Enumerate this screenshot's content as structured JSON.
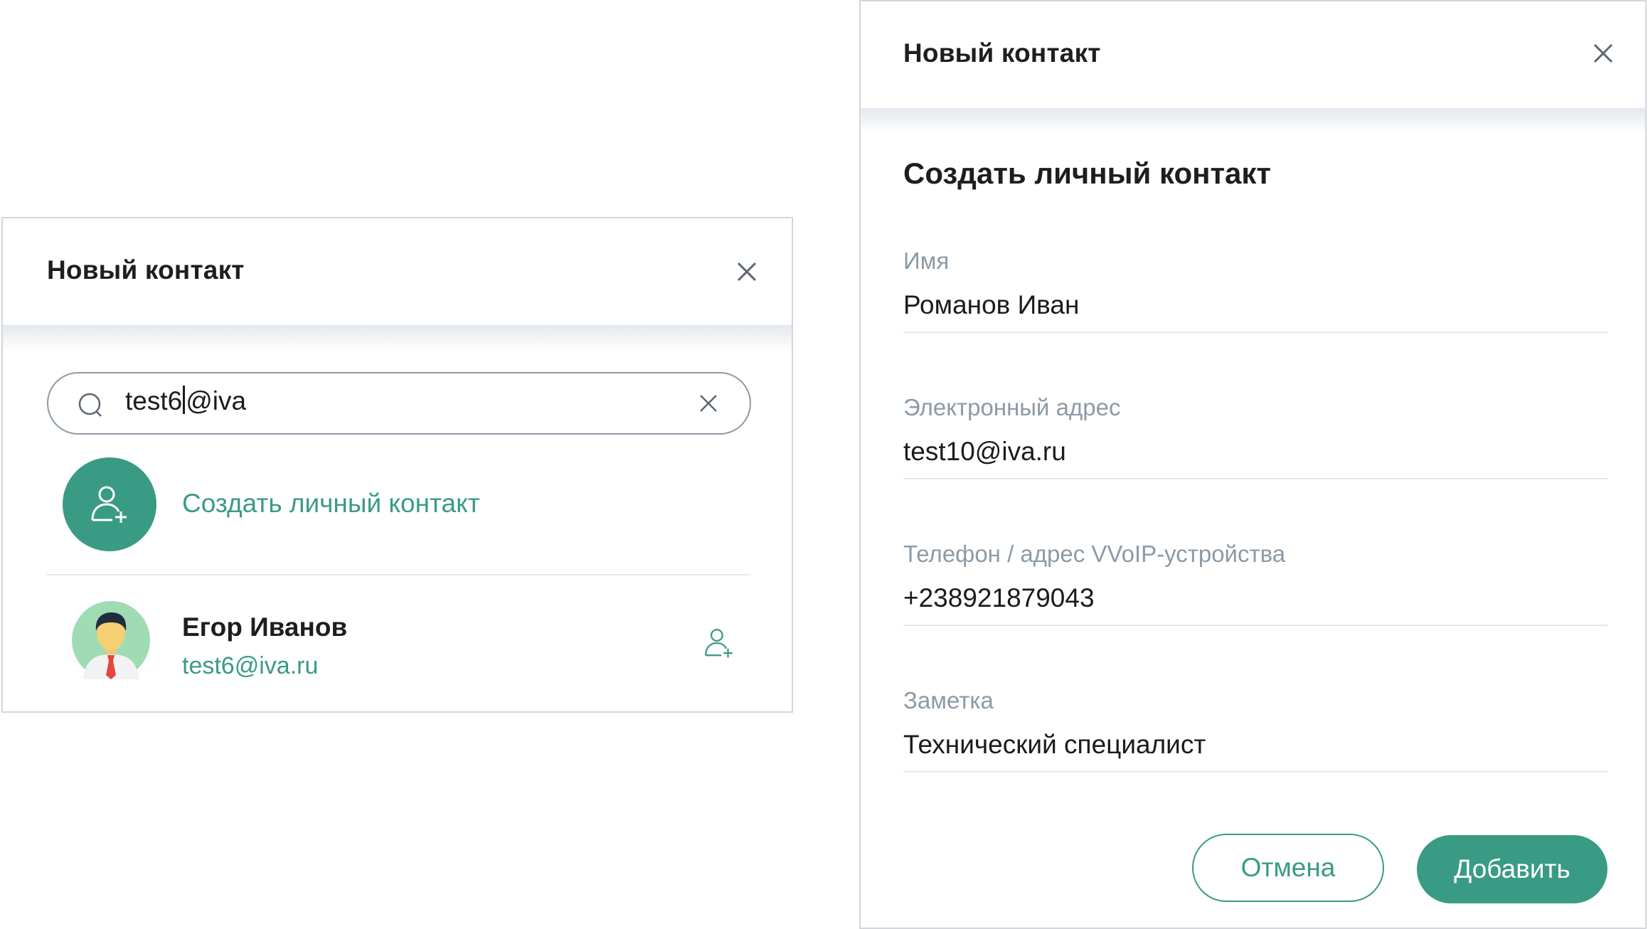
{
  "left_panel": {
    "title": "Новый контакт",
    "search": {
      "value_before_caret": "test6",
      "value_after_caret": "@iva"
    },
    "create_label": "Создать личный контакт",
    "contact": {
      "name": "Егор Иванов",
      "email": "test6@iva.ru"
    }
  },
  "right_panel": {
    "title": "Новый контакт",
    "heading": "Создать личный контакт",
    "fields": [
      {
        "label": "Имя",
        "value": "Романов Иван"
      },
      {
        "label": "Электронный адрес",
        "value": "test10@iva.ru"
      },
      {
        "label": "Телефон / адрес VVoIP-устройства",
        "value": "+238921879043"
      },
      {
        "label": "Заметка",
        "value": "Технический специалист"
      }
    ],
    "cancel_label": "Отмена",
    "add_label": "Добавить"
  },
  "colors": {
    "accent": "#3a9b85",
    "muted": "#8c9aa6",
    "border": "#d3d6da"
  }
}
